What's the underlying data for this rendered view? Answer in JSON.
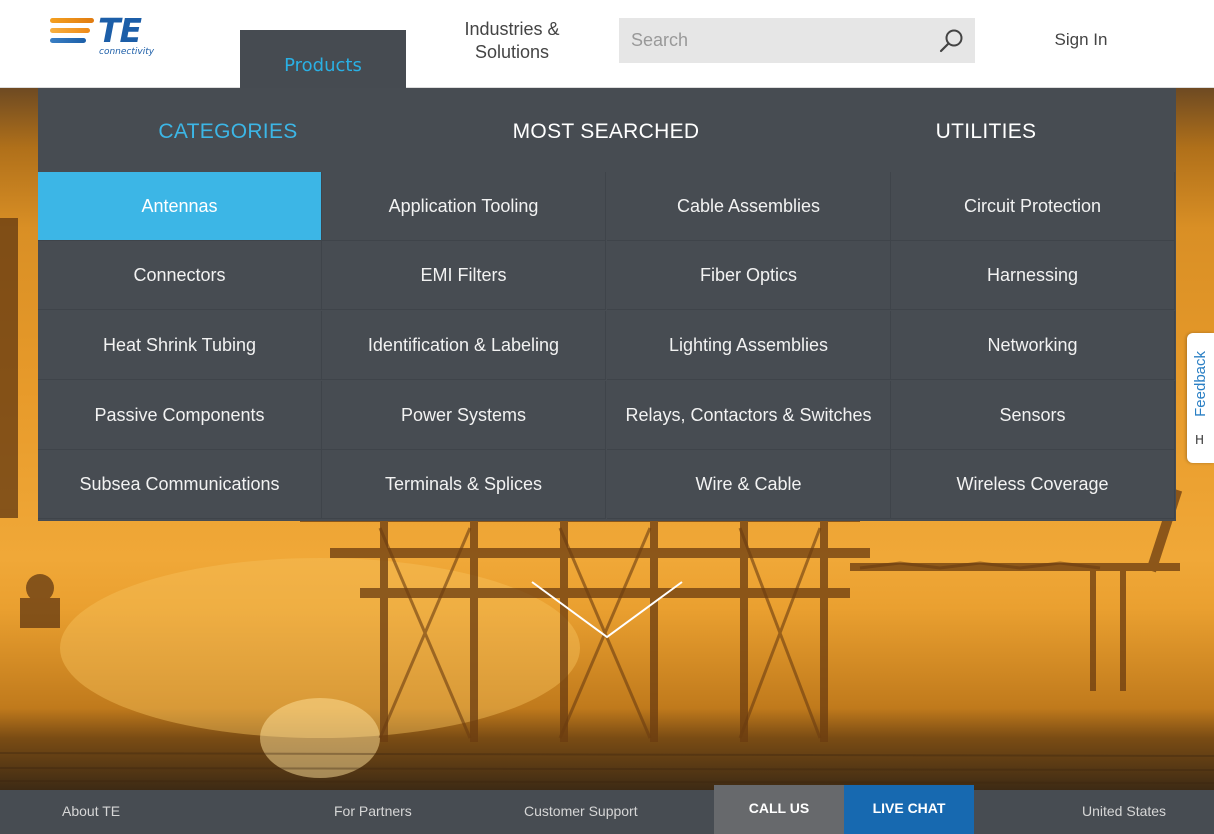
{
  "header": {
    "logo_text": "TE",
    "logo_subtext": "connectivity",
    "nav_products": "Products",
    "nav_industries_line1": "Industries &",
    "nav_industries_line2": "Solutions",
    "search_placeholder": "Search",
    "sign_in": "Sign In"
  },
  "mega_menu": {
    "tabs": [
      {
        "label": "CATEGORIES",
        "active": true
      },
      {
        "label": "MOST SEARCHED",
        "active": false
      },
      {
        "label": "UTILITIES",
        "active": false
      }
    ],
    "categories": [
      "Antennas",
      "Application Tooling",
      "Cable Assemblies",
      "Circuit Protection",
      "Connectors",
      "EMI Filters",
      "Fiber Optics",
      "Harnessing",
      "Heat Shrink Tubing",
      "Identification & Labeling",
      "Lighting Assemblies",
      "Networking",
      "Passive Components",
      "Power Systems",
      "Relays, Contactors & Switches",
      "Sensors",
      "Subsea Communications",
      "Terminals & Splices",
      "Wire & Cable",
      "Wireless Coverage"
    ],
    "selected_category": "Antennas"
  },
  "feedback": {
    "label": "Feedback",
    "icon": "H"
  },
  "footer": {
    "about": "About TE",
    "partners": "For Partners",
    "support": "Customer Support",
    "call_us": "CALL US",
    "live_chat": "LIVE CHAT",
    "region": "United States"
  },
  "colors": {
    "accent": "#3cb6e6",
    "menu_bg": "#474c52",
    "live_chat_bg": "#1769b0",
    "call_us_bg": "#67696c"
  }
}
